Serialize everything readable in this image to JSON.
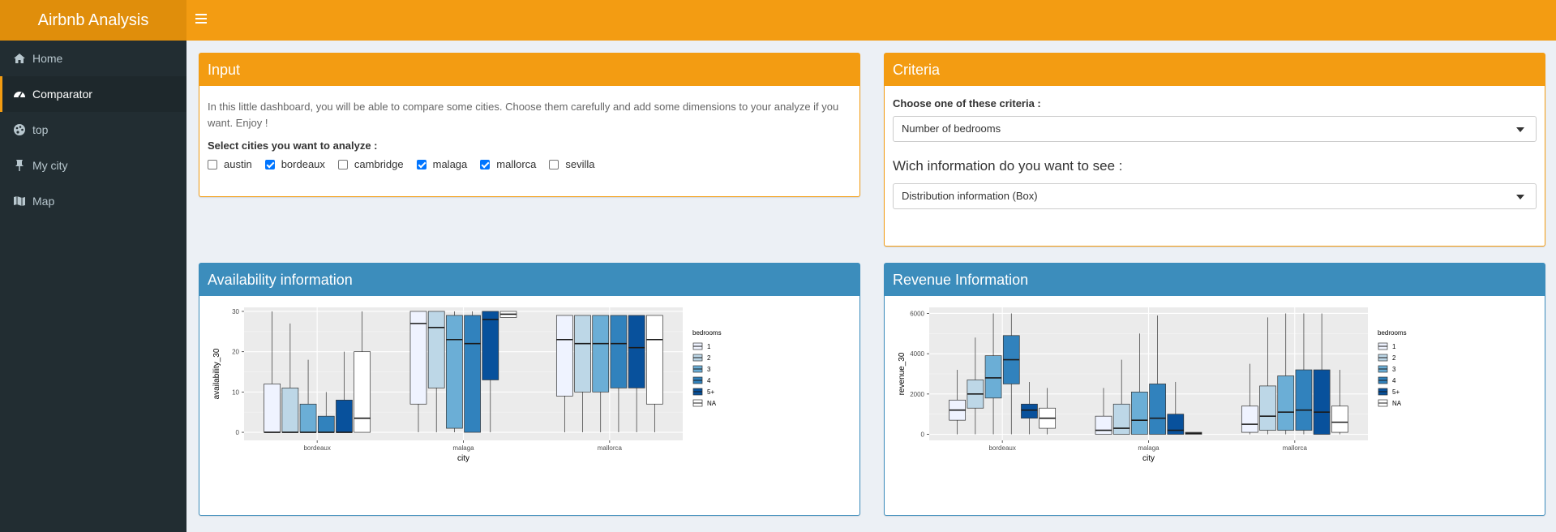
{
  "app": {
    "title": "Airbnb Analysis"
  },
  "sidebar": {
    "items": [
      {
        "label": "Home",
        "icon": "home-icon",
        "active": false
      },
      {
        "label": "Comparator",
        "icon": "dashboard-icon",
        "active": true
      },
      {
        "label": "top",
        "icon": "palette-icon",
        "active": false
      },
      {
        "label": "My city",
        "icon": "pin-icon",
        "active": false
      },
      {
        "label": "Map",
        "icon": "map-icon",
        "active": false
      }
    ]
  },
  "input_box": {
    "title": "Input",
    "description": "In this little dashboard, you will be able to compare some cities. Choose them carefully and add some dimensions to your analyze if you want. Enjoy !",
    "cities_label": "Select cities you want to analyze :",
    "cities": [
      {
        "name": "austin",
        "checked": false
      },
      {
        "name": "bordeaux",
        "checked": true
      },
      {
        "name": "cambridge",
        "checked": false
      },
      {
        "name": "malaga",
        "checked": true
      },
      {
        "name": "mallorca",
        "checked": true
      },
      {
        "name": "sevilla",
        "checked": false
      }
    ]
  },
  "criteria_box": {
    "title": "Criteria",
    "criteria_label": "Choose one of these criteria :",
    "criteria_value": "Number of bedrooms",
    "info_label": "Wich information do you want to see :",
    "info_value": "Distribution information (Box)"
  },
  "colors": {
    "header": "#f39c12",
    "primary": "#3c8dbc",
    "sidebar": "#222d32"
  },
  "chart_data": [
    {
      "type": "box",
      "box_title": "Availability information",
      "xlabel": "city",
      "ylabel": "availability_30",
      "categories": [
        "bordeaux",
        "malaga",
        "mallorca"
      ],
      "yticks": [
        0,
        10,
        20,
        30
      ],
      "ylim": [
        -2,
        31
      ],
      "legend_title": "bedrooms",
      "legend": [
        "1",
        "2",
        "3",
        "4",
        "5+",
        "NA"
      ],
      "fill_colors": [
        "#eff3ff",
        "#bdd7e7",
        "#6baed6",
        "#3182bd",
        "#08519c",
        "#ffffff"
      ],
      "boxes": [
        [
          {
            "min": 0,
            "q1": 0,
            "median": 0,
            "q3": 12,
            "max": 30
          },
          {
            "min": 0,
            "q1": 0,
            "median": 0,
            "q3": 11,
            "max": 27
          },
          {
            "min": 0,
            "q1": 0,
            "median": 0,
            "q3": 7,
            "max": 18
          },
          {
            "min": 0,
            "q1": 0,
            "median": 0,
            "q3": 4,
            "max": 10
          },
          {
            "min": 0,
            "q1": 0,
            "median": 0,
            "q3": 8,
            "max": 20
          },
          {
            "min": 0,
            "q1": 0,
            "median": 3.5,
            "q3": 20,
            "max": 30
          }
        ],
        [
          {
            "min": 0,
            "q1": 7,
            "median": 27,
            "q3": 30,
            "max": 30
          },
          {
            "min": 0,
            "q1": 11,
            "median": 26,
            "q3": 30,
            "max": 30
          },
          {
            "min": 0,
            "q1": 1,
            "median": 23,
            "q3": 29,
            "max": 30
          },
          {
            "min": 0,
            "q1": 0,
            "median": 22,
            "q3": 29,
            "max": 30
          },
          {
            "min": 0,
            "q1": 13,
            "median": 28,
            "q3": 30,
            "max": 30
          },
          {
            "min": 28.5,
            "q1": 28.5,
            "median": 29.3,
            "q3": 30,
            "max": 30
          }
        ],
        [
          {
            "min": 0,
            "q1": 9,
            "median": 23,
            "q3": 29,
            "max": 29
          },
          {
            "min": 0,
            "q1": 10,
            "median": 22,
            "q3": 29,
            "max": 29
          },
          {
            "min": 0,
            "q1": 10,
            "median": 22,
            "q3": 29,
            "max": 29
          },
          {
            "min": 0,
            "q1": 11,
            "median": 22,
            "q3": 29,
            "max": 29
          },
          {
            "min": 0,
            "q1": 11,
            "median": 21,
            "q3": 29,
            "max": 29
          },
          {
            "min": 0,
            "q1": 7,
            "median": 23,
            "q3": 29,
            "max": 29
          }
        ]
      ]
    },
    {
      "type": "box",
      "box_title": "Revenue Information",
      "xlabel": "city",
      "ylabel": "revenue_30",
      "categories": [
        "bordeaux",
        "malaga",
        "mallorca"
      ],
      "yticks": [
        0,
        2000,
        4000,
        6000
      ],
      "ylim": [
        -300,
        6300
      ],
      "legend_title": "bedrooms",
      "legend": [
        "1",
        "2",
        "3",
        "4",
        "5+",
        "NA"
      ],
      "fill_colors": [
        "#eff3ff",
        "#bdd7e7",
        "#6baed6",
        "#3182bd",
        "#08519c",
        "#ffffff"
      ],
      "boxes": [
        [
          {
            "min": 0,
            "q1": 700,
            "median": 1200,
            "q3": 1700,
            "max": 3200
          },
          {
            "min": 0,
            "q1": 1300,
            "median": 2000,
            "q3": 2700,
            "max": 4800
          },
          {
            "min": 0,
            "q1": 1800,
            "median": 2800,
            "q3": 3900,
            "max": 6000
          },
          {
            "min": 0,
            "q1": 2500,
            "median": 3700,
            "q3": 4900,
            "max": 6000
          },
          {
            "min": 0,
            "q1": 800,
            "median": 1200,
            "q3": 1500,
            "max": 2600
          },
          {
            "min": 0,
            "q1": 300,
            "median": 800,
            "q3": 1300,
            "max": 2300
          }
        ],
        [
          {
            "min": 0,
            "q1": 0,
            "median": 200,
            "q3": 900,
            "max": 2300
          },
          {
            "min": 0,
            "q1": 0,
            "median": 300,
            "q3": 1500,
            "max": 3700
          },
          {
            "min": 0,
            "q1": 0,
            "median": 700,
            "q3": 2100,
            "max": 5000
          },
          {
            "min": 0,
            "q1": 0,
            "median": 800,
            "q3": 2500,
            "max": 5900
          },
          {
            "min": 0,
            "q1": 0,
            "median": 200,
            "q3": 1000,
            "max": 2600
          },
          {
            "min": 0,
            "q1": 0,
            "median": 50,
            "q3": 100,
            "max": 100
          }
        ],
        [
          {
            "min": 0,
            "q1": 100,
            "median": 500,
            "q3": 1400,
            "max": 3500
          },
          {
            "min": 0,
            "q1": 200,
            "median": 900,
            "q3": 2400,
            "max": 5800
          },
          {
            "min": 0,
            "q1": 200,
            "median": 1100,
            "q3": 2900,
            "max": 6000
          },
          {
            "min": 0,
            "q1": 200,
            "median": 1200,
            "q3": 3200,
            "max": 6000
          },
          {
            "min": 0,
            "q1": 0,
            "median": 1100,
            "q3": 3200,
            "max": 6000
          },
          {
            "min": 0,
            "q1": 100,
            "median": 600,
            "q3": 1400,
            "max": 3200
          }
        ]
      ]
    }
  ]
}
